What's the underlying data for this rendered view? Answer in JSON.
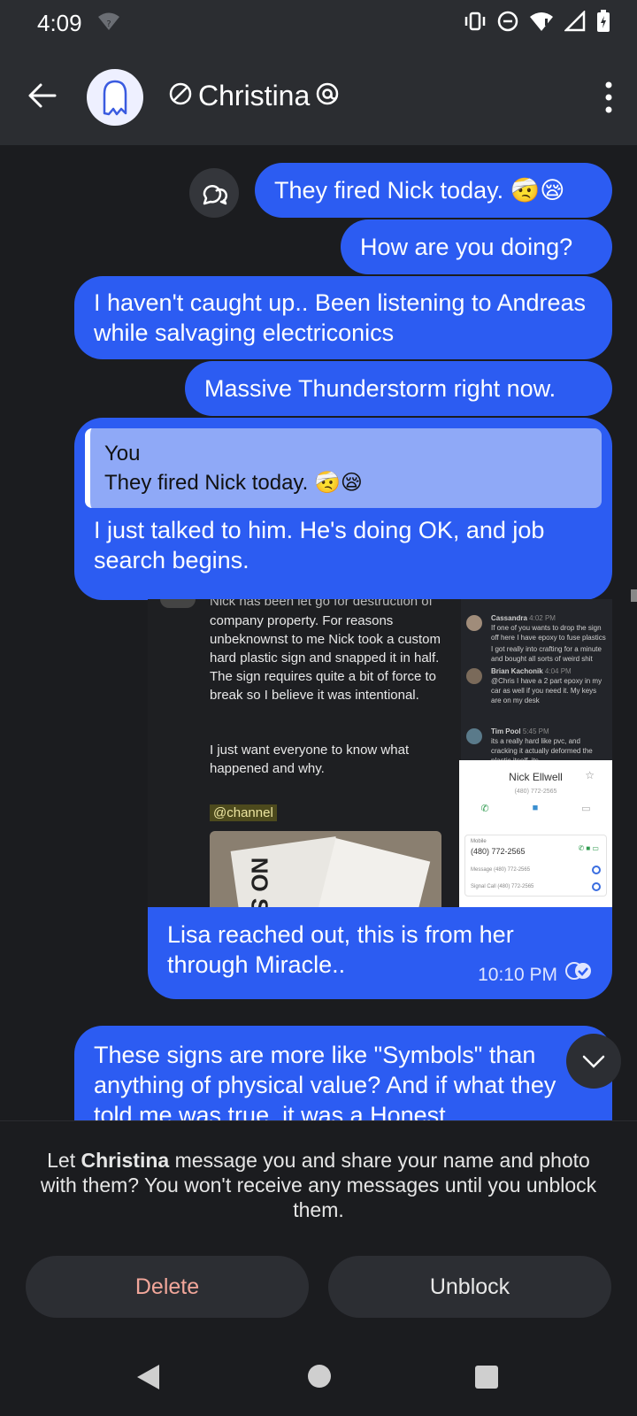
{
  "status_bar": {
    "time": "4:09",
    "wifi_badge": "?"
  },
  "header": {
    "contact_name": "Christina",
    "avatar_icon": "ghost-icon",
    "blocked_icon": "blocked-icon",
    "mention_icon": "at-icon"
  },
  "messages": [
    {
      "text": "They fired Nick today. 🤕😪"
    },
    {
      "text": "How are you doing?"
    },
    {
      "text": "I haven't caught up.. Been listening to Andreas while salvaging electriconics"
    },
    {
      "text": "Massive Thunderstorm right now."
    },
    {
      "quote_author": "You",
      "quote_text": "They fired Nick today. 🤕😪",
      "text": "I just talked to him. He's doing OK, and job search begins."
    },
    {
      "text": "Lisa reached out, this is from her through Miracle..",
      "time": "10:10 PM"
    },
    {
      "text": "These signs are more like \"Symbols\" than anything of physical value? And if what they told me was true, it was a Honest"
    }
  ],
  "attachment": {
    "post_cutoff": "Nick has been let go for destruction of",
    "post_body": "company property. For reasons unbeknownst to me Nick took a custom hard plastic sign and snapped it in half. The sign requires quite a bit of force to break so I believe it was intentional.",
    "post_closing": "I just want everyone to know what happened and why.",
    "mention": "@channel",
    "sign_text": "NO S",
    "side_chat": [
      {
        "name": "Cassandra",
        "time": "4:02 PM",
        "text": "If one of you wants to drop the sign off here I have epoxy to fuse plastics"
      },
      {
        "name": "",
        "time": "",
        "text": "I got really into crafting for a minute and bought all sorts of weird shit"
      },
      {
        "name": "Brian Kachonik",
        "time": "4:04 PM",
        "text": "@Chris I have a 2 part epoxy in my car as well if you need it. My keys are on my desk"
      },
      {
        "name": "Tim Pool",
        "time": "5:45 PM",
        "text": "its a really hard like pvc, and cracking it actually deformed the plastic itself. its"
      }
    ],
    "contact_card": {
      "name": "Nick Ellwell",
      "phone": "(480) 772-2565",
      "mobile_label": "Mobile",
      "mobile_number": "(480) 772-2565",
      "message_row": "Message (480) 772-2565",
      "signal_row": "Signal Call (480) 772-2565"
    }
  },
  "block_prompt": {
    "prefix": "Let ",
    "name": "Christina",
    "suffix": " message you and share your name and photo with them? You won't receive any messages until you unblock them.",
    "delete_label": "Delete",
    "unblock_label": "Unblock"
  },
  "colors": {
    "bubble": "#2c5cf2",
    "background": "#1b1c1f",
    "toolbar": "#2b2d31",
    "delete_text": "#f1a69a"
  }
}
